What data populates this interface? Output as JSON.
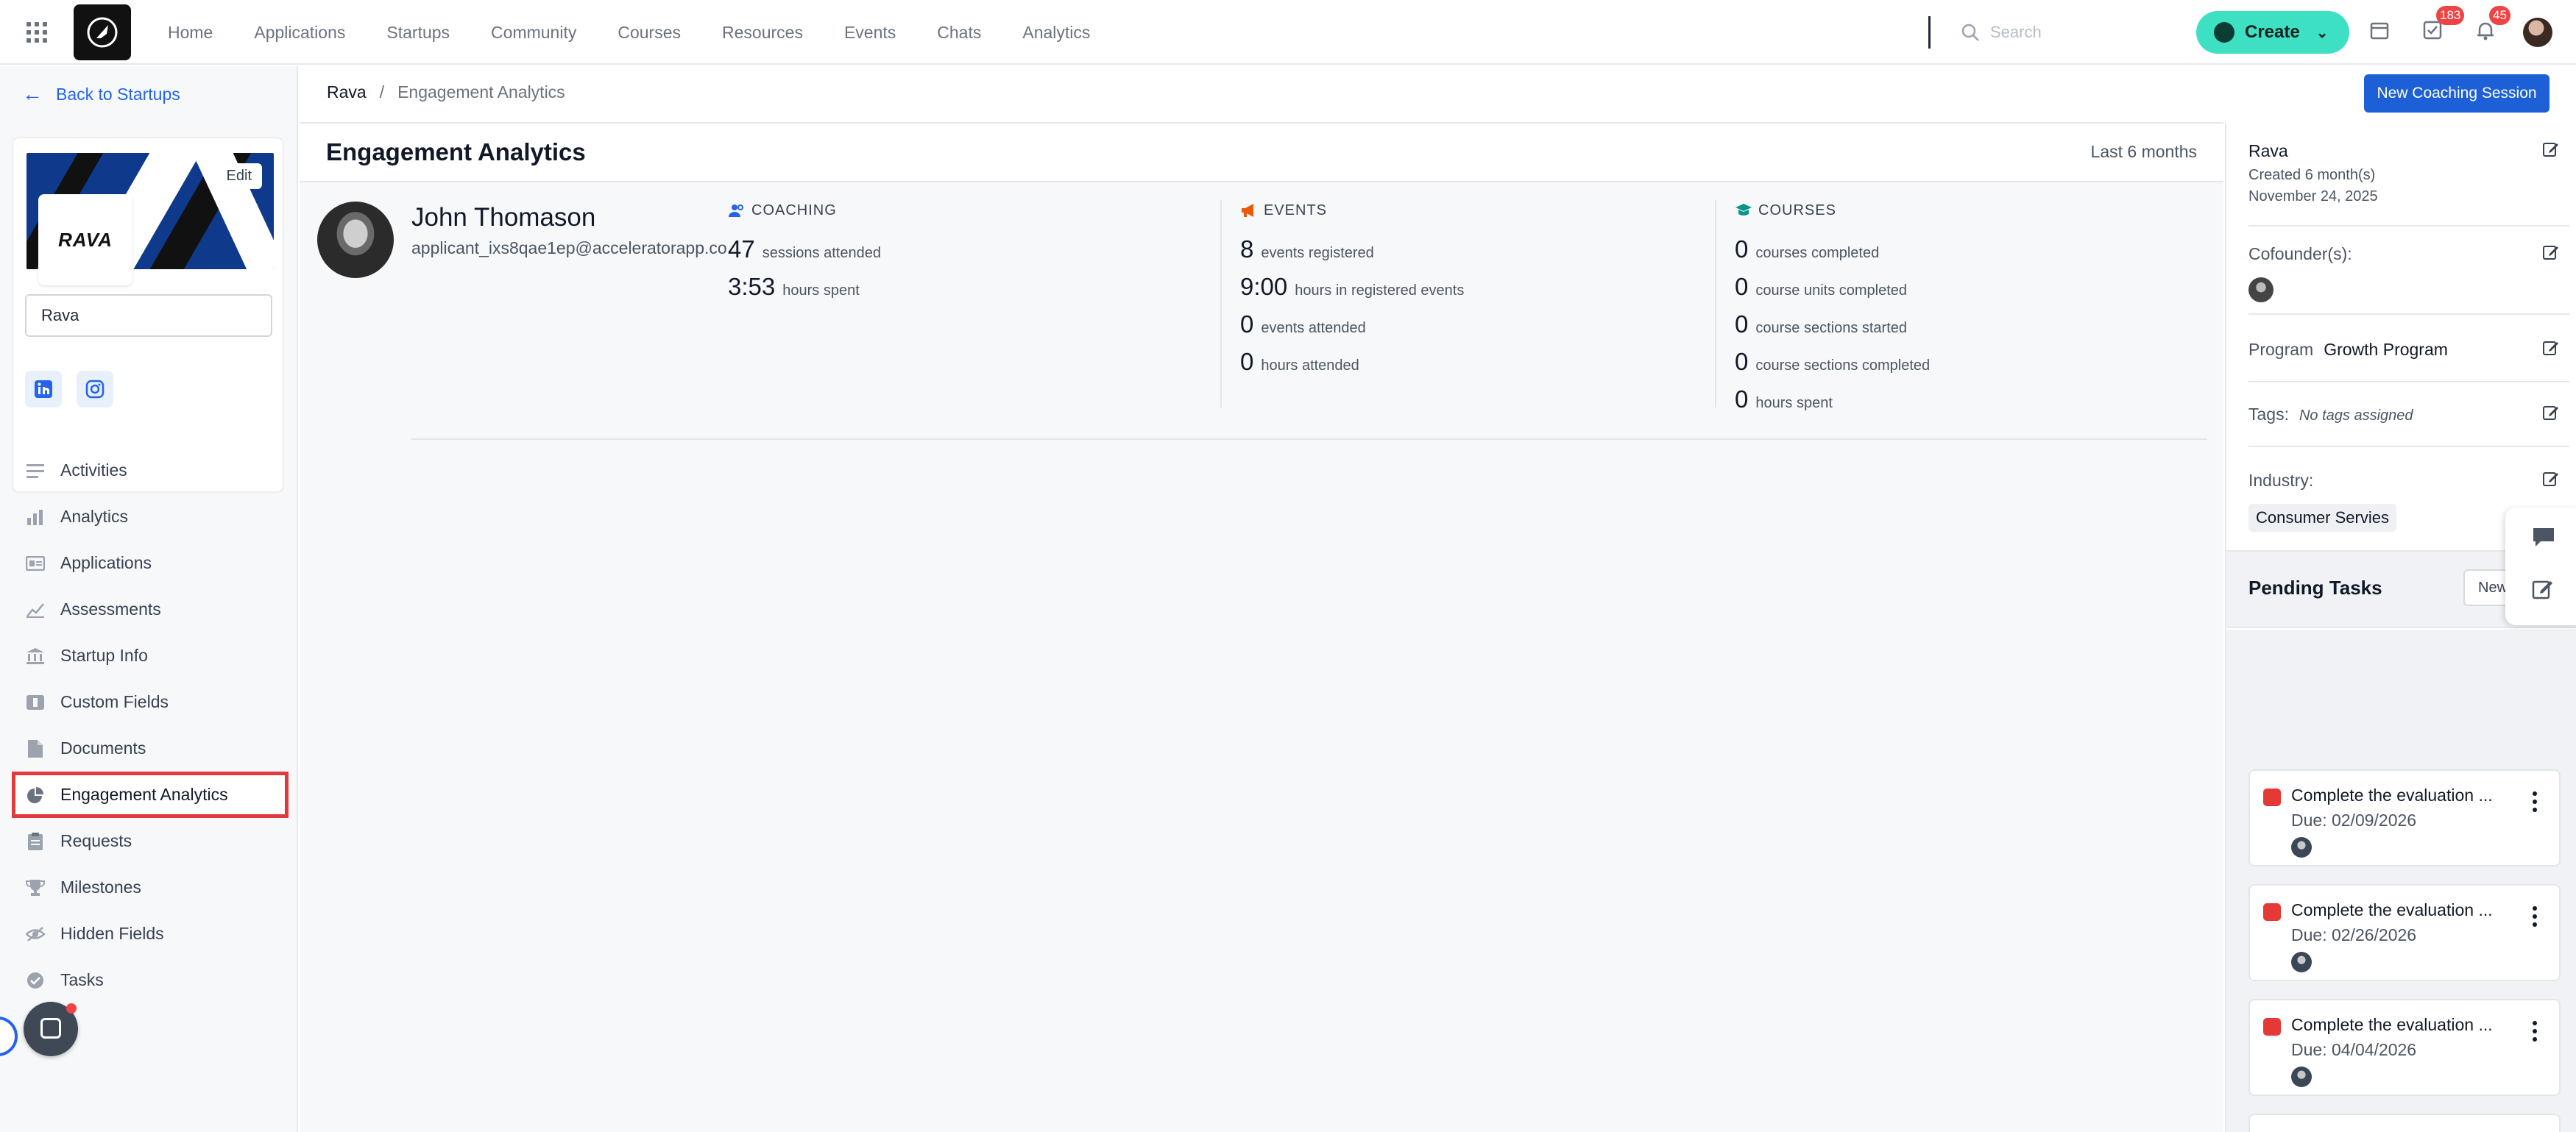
{
  "nav": {
    "items": [
      "Home",
      "Applications",
      "Startups",
      "Community",
      "Courses",
      "Resources",
      "Events",
      "Chats",
      "Analytics"
    ],
    "search_placeholder": "Search",
    "create_label": "Create",
    "tasks_badge": "183",
    "notifications_badge": "45"
  },
  "sidebar": {
    "back_label": "Back to Startups",
    "cover_edit_label": "Edit",
    "logo_text": "RAVA",
    "startup_name": "Rava",
    "menu": [
      {
        "label": "Activities",
        "icon": "list-icon"
      },
      {
        "label": "Analytics",
        "icon": "bar-chart-icon"
      },
      {
        "label": "Applications",
        "icon": "id-card-icon"
      },
      {
        "label": "Assessments",
        "icon": "line-chart-icon"
      },
      {
        "label": "Startup Info",
        "icon": "bank-icon"
      },
      {
        "label": "Custom Fields",
        "icon": "custom-fields-icon"
      },
      {
        "label": "Documents",
        "icon": "document-icon"
      },
      {
        "label": "Engagement Analytics",
        "icon": "pie-chart-icon"
      },
      {
        "label": "Requests",
        "icon": "clipboard-icon"
      },
      {
        "label": "Milestones",
        "icon": "trophy-icon"
      },
      {
        "label": "Hidden Fields",
        "icon": "eye-slash-icon"
      },
      {
        "label": "Tasks",
        "icon": "check-circle-icon"
      }
    ],
    "active_item": "Engagement Analytics"
  },
  "breadcrumb": {
    "parent": "Rava",
    "separator": "/",
    "current": "Engagement Analytics"
  },
  "actions": {
    "new_session_label": "New Coaching Session"
  },
  "main": {
    "title": "Engagement Analytics",
    "period": "Last 6 months",
    "user": {
      "name": "John Thomason",
      "email": "applicant_ixs8qae1ep@acceleratorapp.co"
    },
    "coaching": {
      "heading": "COACHING",
      "stats": [
        {
          "value": "47",
          "label": "sessions attended"
        },
        {
          "value": "3:53",
          "label": "hours spent"
        }
      ]
    },
    "events": {
      "heading": "EVENTS",
      "stats": [
        {
          "value": "8",
          "label": "events registered"
        },
        {
          "value": "9:00",
          "label": "hours in registered events"
        },
        {
          "value": "0",
          "label": "events attended"
        },
        {
          "value": "0",
          "label": "hours attended"
        }
      ]
    },
    "courses": {
      "heading": "COURSES",
      "stats": [
        {
          "value": "0",
          "label": "courses completed"
        },
        {
          "value": "0",
          "label": "course units completed"
        },
        {
          "value": "0",
          "label": "course sections started"
        },
        {
          "value": "0",
          "label": "course sections completed"
        },
        {
          "value": "0",
          "label": "hours spent"
        }
      ]
    }
  },
  "right_panel": {
    "startup_name": "Rava",
    "created_ago": "Created 6 month(s)",
    "created_date": "November 24, 2025",
    "cofounders_label": "Cofounder(s):",
    "program_label": "Program",
    "program_value": "Growth Program",
    "tags_label": "Tags:",
    "tags_empty": "No tags assigned",
    "industry_label": "Industry:",
    "industry_value": "Consumer Servies",
    "pending_title": "Pending Tasks",
    "new_task_label": "New",
    "tasks": [
      {
        "title": "Complete the evaluation ...",
        "due": "Due: 02/09/2026"
      },
      {
        "title": "Complete the evaluation ...",
        "due": "Due: 02/26/2026"
      },
      {
        "title": "Complete the evaluation ...",
        "due": "Due: 04/04/2026"
      }
    ]
  },
  "colors": {
    "accent_blue": "#1d5fd6",
    "create_green": "#3ee0c4",
    "task_red": "#e53935",
    "highlight_red": "#e03a3a"
  }
}
